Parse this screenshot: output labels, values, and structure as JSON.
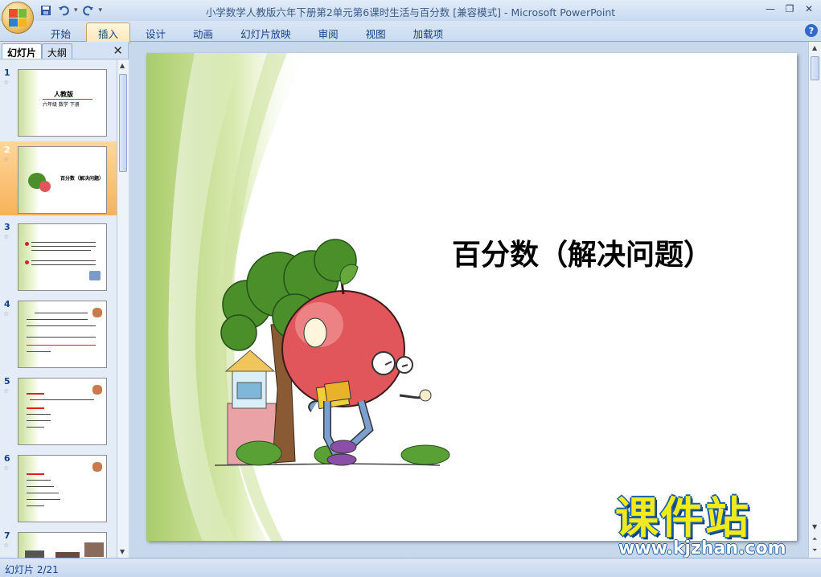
{
  "window": {
    "title": "小学数学人教版六年下册第2单元第6课时生活与百分数 [兼容模式]",
    "app_name": "- Microsoft PowerPoint",
    "controls": {
      "minimize": "—",
      "restore": "❐",
      "close": "✕"
    }
  },
  "quick_access": {
    "save_icon": "save-icon",
    "undo_icon": "undo-icon",
    "redo_icon": "redo-icon"
  },
  "ribbon": {
    "tabs": [
      {
        "label": "开始",
        "active": false
      },
      {
        "label": "插入",
        "active": true
      },
      {
        "label": "设计",
        "active": false
      },
      {
        "label": "动画",
        "active": false
      },
      {
        "label": "幻灯片放映",
        "active": false
      },
      {
        "label": "审阅",
        "active": false
      },
      {
        "label": "视图",
        "active": false
      },
      {
        "label": "加载项",
        "active": false
      }
    ],
    "help": "?"
  },
  "left_pane": {
    "tabs": {
      "slides": "幻灯片",
      "outline": "大纲"
    },
    "close": "✕",
    "thumbnails": [
      {
        "number": "1",
        "anim": "☆",
        "title": "人教版",
        "subtitle": "六年级 数学 下册"
      },
      {
        "number": "2",
        "anim": "☆",
        "title": "百分数（解决问题）",
        "selected": true
      },
      {
        "number": "3",
        "anim": "☆"
      },
      {
        "number": "4",
        "anim": "☆"
      },
      {
        "number": "5",
        "anim": "☆"
      },
      {
        "number": "6",
        "anim": "☆"
      },
      {
        "number": "7",
        "anim": "☆"
      }
    ]
  },
  "slide": {
    "title": "百分数（解决问题）"
  },
  "watermark": {
    "brand": "课件站",
    "url": "www.kjzhan.com"
  },
  "status": {
    "slide_indicator": "幻灯片 2/21"
  },
  "colors": {
    "ribbon_active_tab": "#fde7b4",
    "selected_thumb": "#f7b25a",
    "slide_green": "#b7d57a",
    "apple_red": "#e0565a",
    "tree_green": "#4a8f2a",
    "watermark_yellow": "#f3ea1a",
    "watermark_blue": "#1b5fa8"
  }
}
